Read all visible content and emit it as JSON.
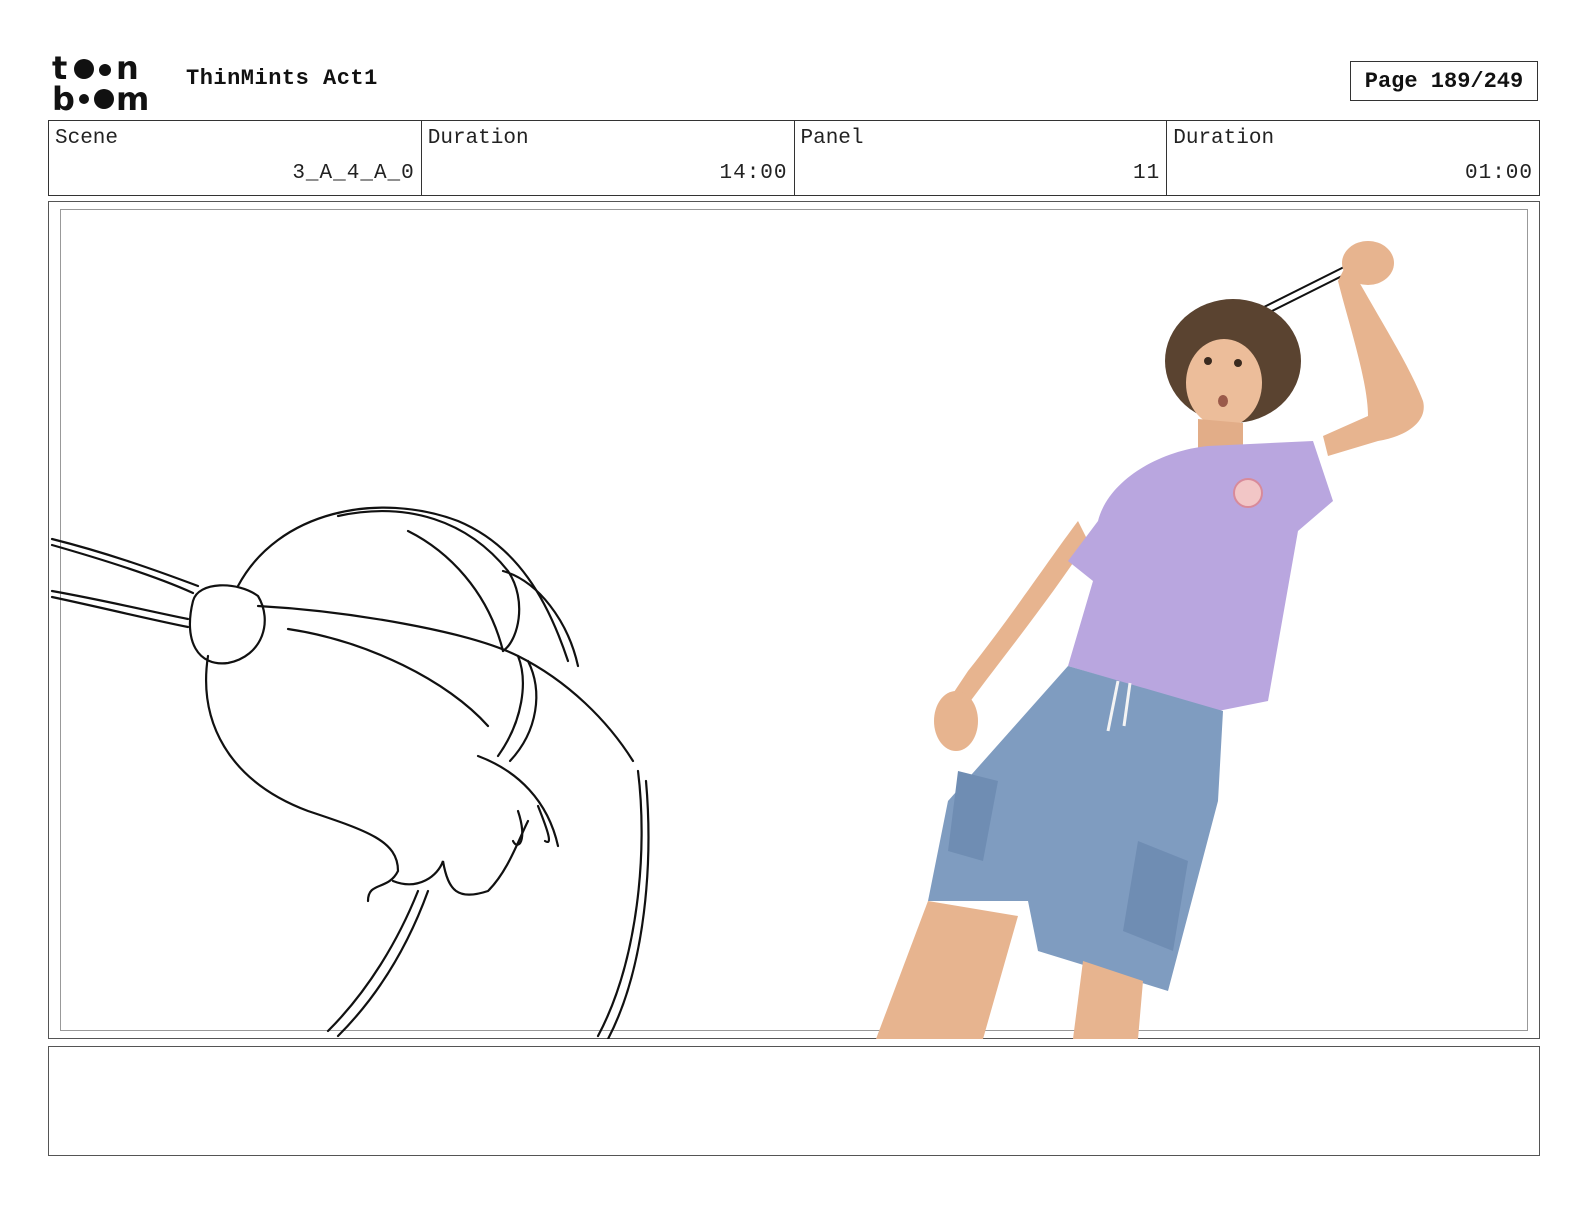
{
  "header": {
    "logo_top": "toon",
    "logo_bottom": "boom",
    "project_title": "ThinMints Act1",
    "page_label": "Page 189/249"
  },
  "info": {
    "scene_label": "Scene",
    "scene_value": "3_A_4_A_0",
    "scene_duration_label": "Duration",
    "scene_duration_value": "14:00",
    "panel_label": "Panel",
    "panel_value": "11",
    "panel_duration_label": "Duration",
    "panel_duration_value": "01:00"
  },
  "panel": {
    "notes": ""
  },
  "colors": {
    "shirt": "#b9a6df",
    "shorts": "#7f9cc0",
    "skin": "#e7b48f",
    "hair": "#5a4330",
    "sketch": "#111111"
  }
}
